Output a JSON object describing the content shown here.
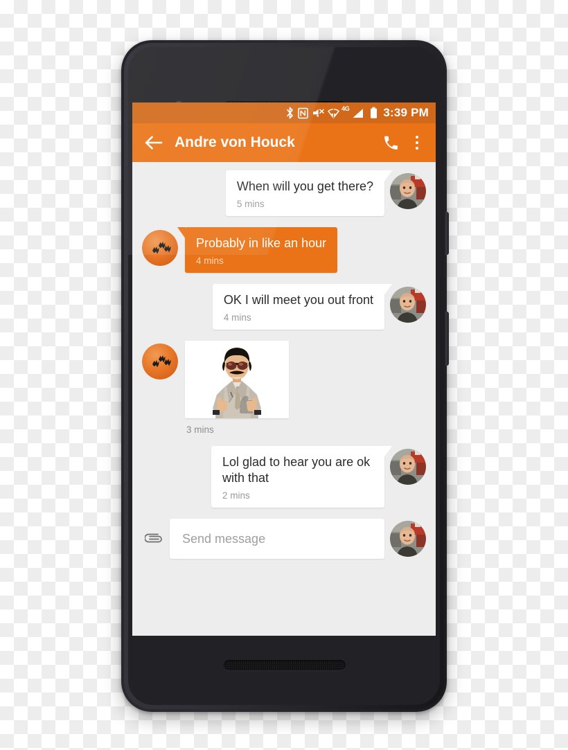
{
  "status_bar": {
    "time": "3:39 PM",
    "network_label": "4G",
    "icons": [
      "bluetooth-icon",
      "nfc-icon",
      "volume-mute-icon",
      "wifi-icon",
      "lte-label",
      "cell-signal-icon",
      "battery-icon"
    ]
  },
  "app_bar": {
    "back_label": "",
    "contact_name": "Andre von Houck",
    "call_label": "",
    "overflow_label": ""
  },
  "conversation": {
    "messages": [
      {
        "id": "m1",
        "direction": "incoming",
        "type": "text",
        "text": "When will you get there?",
        "time": "5 mins"
      },
      {
        "id": "m2",
        "direction": "outgoing",
        "type": "text",
        "text": "Probably in like an hour",
        "time": "4 mins"
      },
      {
        "id": "m3",
        "direction": "incoming",
        "type": "text",
        "text": "OK I will meet you out front",
        "time": "4 mins"
      },
      {
        "id": "m4",
        "direction": "outgoing",
        "type": "image",
        "text": "",
        "time": "3 mins"
      },
      {
        "id": "m5",
        "direction": "incoming",
        "type": "text",
        "text": "Lol glad to hear you are ok with that",
        "time": "2 mins"
      }
    ]
  },
  "composer": {
    "attach_label": "",
    "placeholder": "Send message",
    "value": ""
  },
  "colors": {
    "accent": "#ea7317",
    "status_bar": "#d2691a",
    "chat_background": "#ededed",
    "bubble_incoming": "#ffffff",
    "bubble_outgoing": "#ea7317"
  }
}
